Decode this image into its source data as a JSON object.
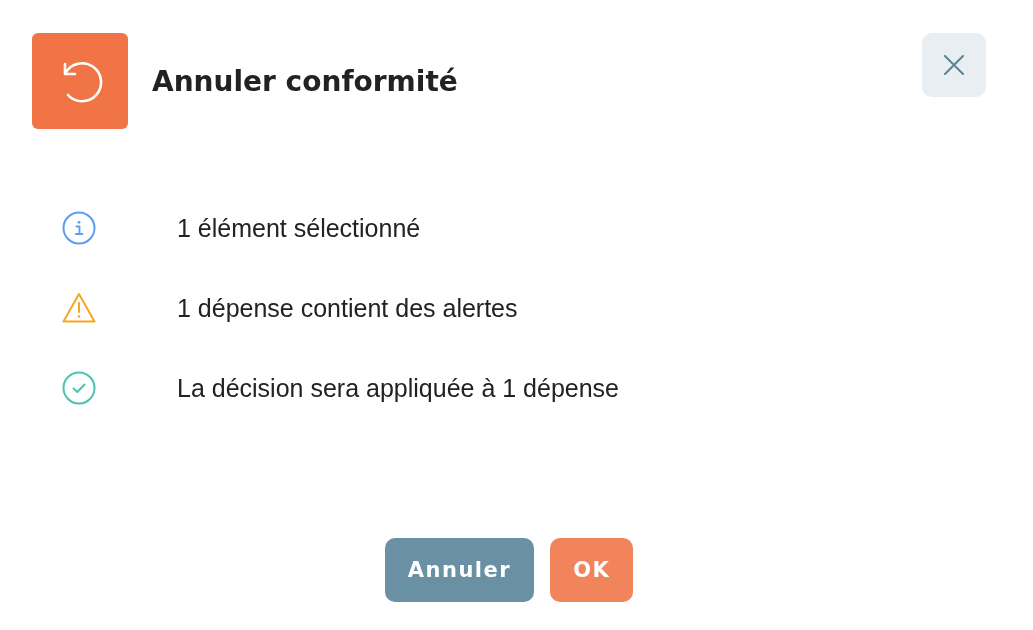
{
  "dialog": {
    "title": "Annuler conformité"
  },
  "messages": [
    {
      "kind": "info",
      "text": "1 élément sélectionné"
    },
    {
      "kind": "warning",
      "text": "1 dépense contient des alertes"
    },
    {
      "kind": "success",
      "text": "La décision sera appliquée à 1 dépense"
    }
  ],
  "buttons": [
    {
      "kind": "secondary",
      "label": "Annuler"
    },
    {
      "kind": "primary",
      "label": "OK"
    }
  ]
}
